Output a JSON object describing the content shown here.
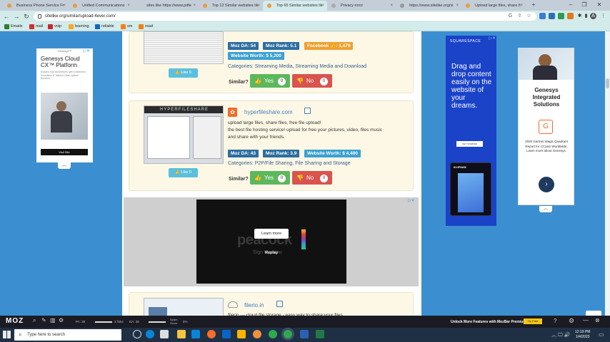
{
  "browser": {
    "tabs": [
      {
        "label": "Business Phone Service Fr"
      },
      {
        "label": "Unified Communications"
      },
      {
        "label": "sites like https://www.pdfe"
      },
      {
        "label": "Top 12 Similar websites lik"
      },
      {
        "label": "Top 65 Similar websites lik",
        "active": true
      },
      {
        "label": "Privacy error"
      },
      {
        "label": "https://www.sitelike.org/si"
      },
      {
        "label": "Upload large files, share fi"
      }
    ],
    "new_tab": "+",
    "url": "sitelike.org/similar/upload-4ever.com/",
    "profile_initial": "A",
    "bookmarks": [
      {
        "label": "Emails",
        "color": "#2e7d32"
      },
      {
        "label": "mail",
        "color": "#d32f2f"
      },
      {
        "label": "voip",
        "color": "#c62828"
      },
      {
        "label": "learning",
        "color": "#f9a825"
      },
      {
        "label": "reliable",
        "color": "#1565c0"
      },
      {
        "label": "sm",
        "color": "#f57f17"
      },
      {
        "label": "read",
        "color": "#f57f17"
      }
    ]
  },
  "listing1": {
    "moz_da": "Moz DA: 54",
    "moz_rank": "Moz Rank: 5.1",
    "facebook": "Facebook 👍: 1,479",
    "worth": "Website Worth: $ 5,200",
    "categories": "Categories:  Streaming Media, Streaming Media and Download",
    "similar": "Similar?",
    "yes": "Yes",
    "yes_count": "0",
    "no": "No",
    "no_count": "0",
    "like": "Like",
    "like_count": "0"
  },
  "listing2": {
    "site": "hyperfileshare.com",
    "desc1": "upload large files, share files, free file upload!",
    "desc2": "the best file hosting service! upload for free your pictures, video, files music",
    "desc3": "and share with your friends.",
    "moz_da": "Moz DA: 43",
    "moz_rank": "Moz Rank: 3.9",
    "worth": "Website Worth: $ 4,400",
    "categories": "Categories:  P2P/File Sharing, File Sharing and Storage",
    "similar": "Similar?",
    "yes": "Yes",
    "yes_count": "0",
    "no": "No",
    "no_count": "0",
    "like": "Like",
    "like_count": "0",
    "thumb_caption": "HYPERFILESHARE"
  },
  "listing3": {
    "site": "filerio.in",
    "desc": "filerio — cloud file storage - easy way to share your files"
  },
  "video_ad": {
    "learn_more": "Learn more",
    "brand": "peacock",
    "signup": "Sign Up Now",
    "replay": "Replay"
  },
  "ad_left": {
    "brand": "Genesys™",
    "headline": "Genesys Cloud CX™ Platform",
    "body": "Expand how businesses with confidence, innovation & Tailored Grab system Solution",
    "cta": "Visit Site"
  },
  "ad_right": {
    "headline": "Genesys Integrated Solutions",
    "body": "2020 Gartner Magic Quadrant Report for CCaaS Worldwide. Learn more about Genesys."
  },
  "ad_middle": {
    "brand": "SQUARESPACE",
    "headline": "Drag and drop content easily on the website of your dreams.",
    "cta": "GET STARTED",
    "phone_label": "KLIPSAN"
  },
  "mozbar": {
    "logo": "MOZ",
    "pa": "PA: 38",
    "links": "3 links",
    "da": "DA: 38",
    "spam": "Spam Score",
    "spam_val": "6%",
    "promo": "Unlock More Features with MozBar Premium",
    "try": "Try Free"
  },
  "taskbar": {
    "search_placeholder": "Type here to search",
    "time": "12:19 PM",
    "date": "1/4/2023"
  }
}
